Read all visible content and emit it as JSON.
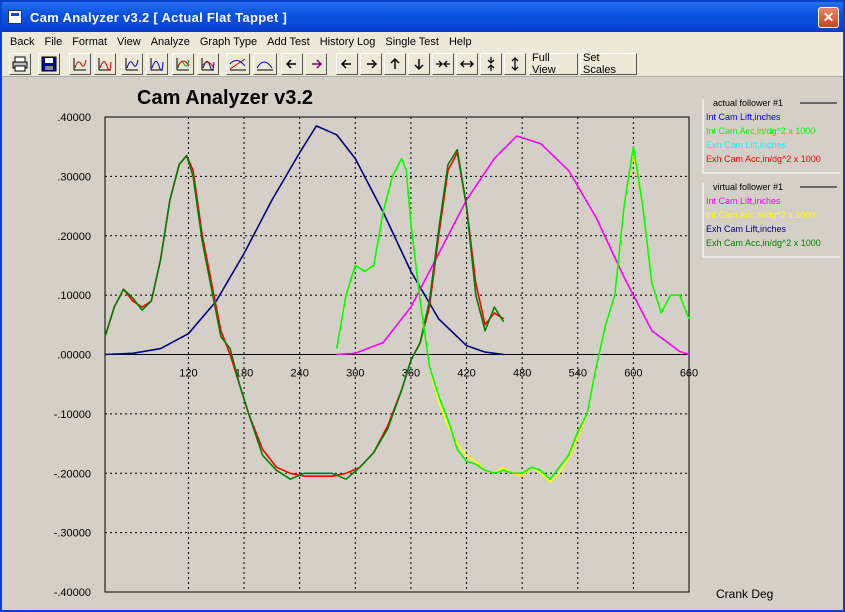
{
  "window": {
    "title": "Cam Analyzer v3.2  [ Actual Flat Tappet ]",
    "close_label": "✕"
  },
  "menu": [
    "Back",
    "File",
    "Format",
    "View",
    "Analyze",
    "Graph Type",
    "Add Test",
    "History Log",
    "Single Test",
    "Help"
  ],
  "toolbar": {
    "icons": [
      "print-icon",
      "save-icon",
      "graph1-icon",
      "graph2-icon",
      "graph3-icon",
      "graph4-icon",
      "graph5-icon",
      "graph6-icon",
      "overlay-icon",
      "curve-icon",
      "shift-left-icon",
      "shift-right-icon",
      "arrow-left-icon",
      "arrow-right-icon",
      "arrow-up-icon",
      "arrow-down-icon",
      "compress-h-icon",
      "expand-h-icon",
      "compress-v-icon",
      "expand-v-icon"
    ],
    "full_view_label": "Full View",
    "set_scales_label": "Set Scales"
  },
  "chart_data": {
    "type": "line",
    "title": "Cam Analyzer v3.2",
    "xlabel": "Crank Deg",
    "ylabel": "",
    "xlim": [
      30,
      660
    ],
    "ylim": [
      -0.4,
      0.4
    ],
    "x_ticks": [
      "120",
      "180",
      "240",
      "300",
      "360",
      "420",
      "480",
      "540",
      "600",
      "660"
    ],
    "y_ticks": [
      ".40000",
      ".30000",
      ".20000",
      ".10000",
      ".00000",
      "-.10000",
      "-.20000",
      "-.30000",
      "-.40000"
    ],
    "grid": true,
    "legend_groups": [
      {
        "title": "actual follower #1",
        "entries": [
          {
            "label": "Int Cam Lift,inches",
            "color": "#0000ff"
          },
          {
            "label": "Int Cam Acc,in/dg^2 x 1000",
            "color": "#00ff00"
          },
          {
            "label": "Exh Cam Lift,inches",
            "color": "#00ffff"
          },
          {
            "label": "Exh Cam Acc,in/dg^2 x 1000",
            "color": "#ff0000"
          }
        ]
      },
      {
        "title": "virtual follower #1",
        "entries": [
          {
            "label": "Int Cam Lift,inches",
            "color": "#ff00ff"
          },
          {
            "label": "Int Cam Acc,in/dg^2 x 1000",
            "color": "#ffff00"
          },
          {
            "label": "Exh Cam Lift,inches",
            "color": "#000080"
          },
          {
            "label": "Exh Cam Acc,in/dg^2 x 1000",
            "color": "#008000"
          }
        ]
      }
    ],
    "series": [
      {
        "color": "#000080",
        "x": [
          30,
          60,
          90,
          120,
          150,
          180,
          210,
          240,
          258,
          280,
          300,
          330,
          360,
          390,
          420,
          440,
          460
        ],
        "y": [
          0,
          0.002,
          0.01,
          0.035,
          0.09,
          0.17,
          0.26,
          0.34,
          0.385,
          0.37,
          0.33,
          0.24,
          0.14,
          0.06,
          0.015,
          0.004,
          0
        ]
      },
      {
        "color": "#ff00ff",
        "x": [
          280,
          300,
          330,
          360,
          390,
          420,
          450,
          474,
          500,
          530,
          560,
          590,
          620,
          650,
          660
        ],
        "y": [
          0,
          0.002,
          0.02,
          0.08,
          0.17,
          0.26,
          0.33,
          0.368,
          0.355,
          0.31,
          0.23,
          0.13,
          0.04,
          0.005,
          0
        ]
      },
      {
        "color": "#ff0000",
        "x": [
          30,
          40,
          50,
          60,
          70,
          80,
          90,
          100,
          110,
          118,
          125,
          135,
          145,
          155,
          165,
          175,
          185,
          200,
          215,
          230,
          245,
          260,
          275,
          290,
          305,
          320,
          335,
          350,
          360,
          370,
          380,
          390,
          400,
          410,
          420,
          430,
          440,
          450,
          460
        ],
        "y": [
          0.03,
          0.08,
          0.11,
          0.09,
          0.08,
          0.09,
          0.16,
          0.26,
          0.32,
          0.335,
          0.31,
          0.2,
          0.12,
          0.04,
          0,
          -0.05,
          -0.1,
          -0.16,
          -0.19,
          -0.2,
          -0.205,
          -0.205,
          -0.205,
          -0.2,
          -0.19,
          -0.165,
          -0.12,
          -0.06,
          -0.01,
          0.02,
          0.08,
          0.2,
          0.31,
          0.34,
          0.25,
          0.12,
          0.05,
          0.07,
          0.06
        ]
      },
      {
        "color": "#008000",
        "x": [
          30,
          40,
          50,
          60,
          70,
          80,
          90,
          100,
          110,
          118,
          125,
          135,
          145,
          155,
          165,
          175,
          185,
          200,
          215,
          230,
          245,
          260,
          275,
          290,
          305,
          320,
          335,
          350,
          360,
          370,
          380,
          390,
          400,
          410,
          420,
          430,
          440,
          450,
          460
        ],
        "y": [
          0.03,
          0.08,
          0.11,
          0.095,
          0.075,
          0.09,
          0.16,
          0.26,
          0.32,
          0.335,
          0.3,
          0.19,
          0.11,
          0.03,
          0.01,
          -0.05,
          -0.1,
          -0.17,
          -0.195,
          -0.21,
          -0.2,
          -0.2,
          -0.2,
          -0.21,
          -0.19,
          -0.165,
          -0.125,
          -0.06,
          -0.01,
          0.02,
          0.09,
          0.21,
          0.32,
          0.345,
          0.25,
          0.1,
          0.04,
          0.08,
          0.055
        ]
      },
      {
        "color": "#ffff00",
        "x": [
          280,
          290,
          300,
          310,
          320,
          330,
          340,
          350,
          355,
          360,
          370,
          380,
          390,
          400,
          410,
          420,
          430,
          440,
          450,
          460,
          470,
          480,
          490,
          500,
          510,
          520,
          530,
          540,
          550,
          560,
          570,
          580,
          590,
          600,
          610,
          620,
          630,
          640,
          650,
          660
        ],
        "y": [
          0.01,
          0.1,
          0.15,
          0.14,
          0.15,
          0.24,
          0.3,
          0.33,
          0.31,
          0.22,
          0.09,
          -0.02,
          -0.08,
          -0.12,
          -0.15,
          -0.17,
          -0.18,
          -0.195,
          -0.2,
          -0.19,
          -0.2,
          -0.205,
          -0.19,
          -0.2,
          -0.215,
          -0.2,
          -0.175,
          -0.14,
          -0.1,
          -0.02,
          0.05,
          0.1,
          0.25,
          0.34,
          0.25,
          0.12,
          0.07,
          0.1,
          0.1,
          0.06
        ]
      },
      {
        "color": "#00ff00",
        "x": [
          280,
          290,
          300,
          310,
          320,
          330,
          340,
          350,
          355,
          360,
          370,
          380,
          390,
          400,
          410,
          420,
          430,
          440,
          450,
          460,
          470,
          480,
          490,
          500,
          510,
          520,
          530,
          540,
          550,
          560,
          570,
          580,
          590,
          600,
          610,
          620,
          630,
          640,
          650,
          660
        ],
        "y": [
          0.01,
          0.1,
          0.15,
          0.14,
          0.15,
          0.24,
          0.3,
          0.33,
          0.31,
          0.22,
          0.09,
          -0.02,
          -0.07,
          -0.11,
          -0.16,
          -0.18,
          -0.185,
          -0.195,
          -0.2,
          -0.195,
          -0.2,
          -0.2,
          -0.19,
          -0.195,
          -0.21,
          -0.19,
          -0.17,
          -0.13,
          -0.1,
          -0.02,
          0.05,
          0.1,
          0.25,
          0.35,
          0.25,
          0.12,
          0.07,
          0.1,
          0.1,
          0.06
        ]
      }
    ]
  }
}
